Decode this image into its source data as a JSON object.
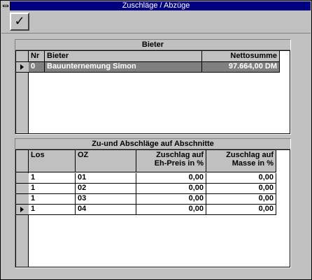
{
  "window": {
    "title": "Zuschläge / Abzüge"
  },
  "toolbar": {
    "ok_icon": "checkmark-icon",
    "ok_glyph": "✓"
  },
  "bieter_panel": {
    "title": "Bieter",
    "columns": [
      "Nr",
      "Bieter",
      "Nettosumme"
    ],
    "rows": [
      {
        "nr": "0",
        "bieter": "Bauunternemung Simon",
        "nettosumme": "97.664,00 DM",
        "selected": true
      }
    ]
  },
  "abschnitte_panel": {
    "title": "Zu-und Abschläge auf Abschnitte",
    "columns": [
      "Los",
      "OZ",
      "Zuschlag auf Eh-Preis in %",
      "Zuschlag auf Masse in %"
    ],
    "column_lines": [
      [
        "Los"
      ],
      [
        "OZ"
      ],
      [
        "Zuschlag auf",
        "Eh-Preis in %"
      ],
      [
        "Zuschlag auf",
        "Masse in %"
      ]
    ],
    "rows": [
      {
        "los": "1",
        "oz": "01",
        "eh": "0,00",
        "masse": "0,00"
      },
      {
        "los": "1",
        "oz": "02",
        "eh": "0,00",
        "masse": "0,00"
      },
      {
        "los": "1",
        "oz": "03",
        "eh": "0,00",
        "masse": "0,00"
      },
      {
        "los": "1",
        "oz": "04",
        "eh": "0,00",
        "masse": "0,00",
        "current": true
      }
    ]
  }
}
